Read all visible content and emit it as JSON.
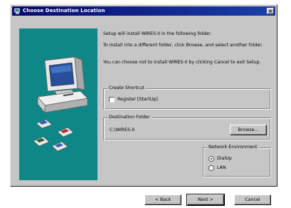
{
  "window": {
    "title": "Choose Destination Location",
    "close_glyph": "×"
  },
  "messages": {
    "line1": "Setup will install WIRES-II in the following folder.",
    "line2": "To install into a different folder, click Browse, and select another folder.",
    "line3": "You can choose not to install WIRES-II by clicking Cancel to exit Setup."
  },
  "shortcut_group": {
    "label": "Create Shortcut",
    "checkbox_label": "Register [StartUp]",
    "checked": false
  },
  "destination_group": {
    "label": "Destination Folder",
    "path": "C:\\WIRES-II",
    "browse_label": "Browse..."
  },
  "network_group": {
    "label": "Network Environment",
    "options": [
      {
        "label": "DialUp",
        "selected": true
      },
      {
        "label": "LAN",
        "selected": false
      }
    ]
  },
  "buttons": {
    "back": "< Back",
    "next": "Next >",
    "cancel": "Cancel"
  },
  "icons": {
    "title": "setup-app-icon",
    "illustration": "computer-with-disks-illustration"
  },
  "colors": {
    "titlebar": "#06086e",
    "illustration_bg": "#0f8787",
    "dialog_bg": "#c6c6c6"
  }
}
